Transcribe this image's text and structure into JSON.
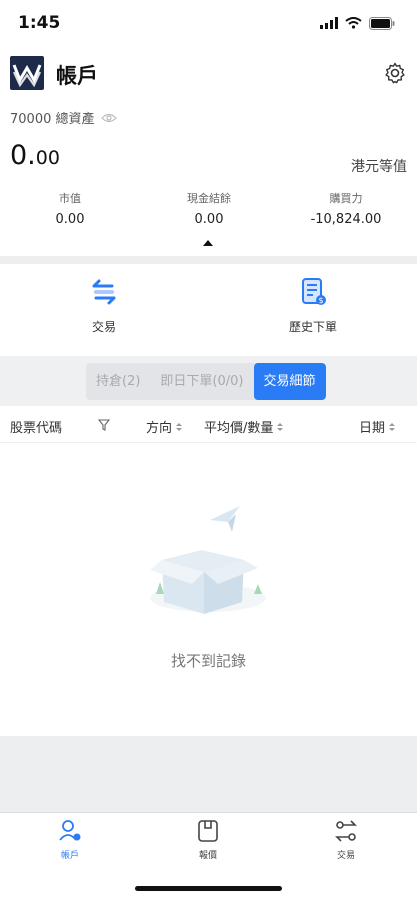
{
  "status_bar": {
    "time": "1:45"
  },
  "header": {
    "title": "帳戶"
  },
  "summary": {
    "assets_label": "70000 總資產",
    "amount_main": "0.",
    "amount_decimal": "00",
    "currency": "港元等值",
    "stats": [
      {
        "label": "市值",
        "value": "0.00"
      },
      {
        "label": "現金結餘",
        "value": "0.00"
      },
      {
        "label": "購買力",
        "value": "-10,824.00"
      }
    ]
  },
  "actions": [
    {
      "label": "交易",
      "icon": "swap-arrows-icon"
    },
    {
      "label": "歷史下單",
      "icon": "history-order-icon"
    }
  ],
  "tabs": [
    {
      "label": "持倉(2)",
      "active": false
    },
    {
      "label": "即日下單(0/0)",
      "active": false
    },
    {
      "label": "交易細節",
      "active": true
    }
  ],
  "columns": {
    "code": "股票代碼",
    "direction": "方向",
    "avg_price_qty": "平均價/數量",
    "date": "日期"
  },
  "empty_state": {
    "text": "找不到記錄"
  },
  "tabbar": [
    {
      "label": "帳戶",
      "icon": "account-icon",
      "active": true
    },
    {
      "label": "報價",
      "icon": "quote-icon",
      "active": false
    },
    {
      "label": "交易",
      "icon": "trade-icon",
      "active": false
    }
  ],
  "colors": {
    "accent": "#2a7bf6",
    "logo_bg": "#1e2a4a",
    "band": "#edeef0"
  }
}
